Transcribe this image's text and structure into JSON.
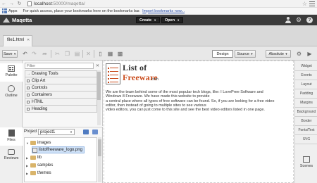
{
  "browser": {
    "url_host": "localhost",
    "url_rest": ":50000/maqetta/",
    "bookmarks_apps": "Apps",
    "bookmarks_hint": "For quick access, place your bookmarks here on the bookmarks bar.",
    "bookmarks_link": "Import bookmarks now..."
  },
  "app": {
    "name": "Maqetta",
    "create_label": "Create",
    "open_label": "Open"
  },
  "tabs": [
    {
      "label": "file1.html"
    }
  ],
  "toolbar": {
    "save_label": "Save",
    "design_label": "Design",
    "source_label": "Source",
    "absolute_label": "Absolute"
  },
  "left_rail": {
    "palette": "Palette",
    "outline": "Outline",
    "files": "Files",
    "reviews": "Reviews"
  },
  "palette": {
    "filter_placeholder": "Filter",
    "items": [
      {
        "label": "Drawing Tools",
        "kind": "arrow"
      },
      {
        "label": "Clip Art",
        "kind": "box"
      },
      {
        "label": "Controls",
        "kind": "box"
      },
      {
        "label": "Containers",
        "kind": "box"
      },
      {
        "label": "HTML",
        "kind": "box"
      },
      {
        "label": "Heading",
        "kind": "box"
      }
    ]
  },
  "project": {
    "label": "Project",
    "selected": "project1",
    "tree": [
      {
        "label": "images",
        "type": "folder",
        "expanded": true
      },
      {
        "label": "listoffreeware_logo.png",
        "type": "file",
        "selected": true
      },
      {
        "label": "lib",
        "type": "folder",
        "expanded": false
      },
      {
        "label": "samples",
        "type": "folder",
        "expanded": false
      },
      {
        "label": "themes",
        "type": "folder",
        "expanded": false
      }
    ]
  },
  "canvas": {
    "logo_line1": "List of",
    "logo_line2": "Freeware",
    "logo_suffix": ".com",
    "text_lines": [
      "We are the team behind some of the most popular tech blogs, like: I LovePree Software and",
      "Windows 8 Freeware. We have made this website to provide",
      "a central place where all types of free software can be found. So, if you are looking for a free video",
      "editor, then instead of going to multiple sites to see various",
      "video editors, you can just come to this site and see the best video editors listed in one page."
    ]
  },
  "right_rail": {
    "items": [
      "Widget",
      "Events",
      "Layout",
      "Padding",
      "Margins",
      "Background",
      "Border",
      "Fonts/Text",
      "SVG"
    ],
    "scenes": "Scenes"
  },
  "colors": {
    "header_bg": "#3b3b3b",
    "logo_accent": "#c94a1a",
    "selection": "#cfe1f7"
  }
}
